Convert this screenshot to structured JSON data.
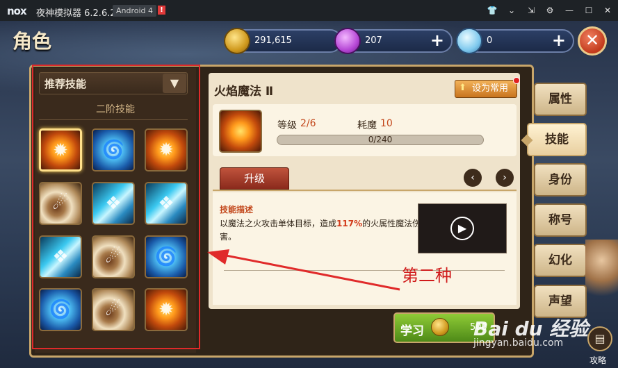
{
  "titlebar": {
    "logo": "nox",
    "app_title": "夜神模拟器 6.2.6.2",
    "android_badge": "Android 4",
    "warn_badge": "!",
    "icons": [
      "shirt-icon",
      "chevron-down-icon",
      "pin-icon",
      "gear-icon",
      "minimize-icon",
      "maximize-icon",
      "close-icon"
    ]
  },
  "header": {
    "page_title": "角色",
    "gold": "291,615",
    "gems": "207",
    "diamonds": "0",
    "plus": "+",
    "close": "✕"
  },
  "left": {
    "dropdown_label": "推荐技能",
    "dropdown_arrow": "▼",
    "tier_label": "二阶技能",
    "skills": [
      "fire",
      "tornado",
      "fire",
      "meteor",
      "crystal",
      "crystal",
      "crystal",
      "meteor",
      "tornado",
      "tornado",
      "meteor",
      "fire"
    ]
  },
  "detail": {
    "title": "火焰魔法 Ⅱ",
    "set_common": "设为常用",
    "level_label": "等级",
    "level_value": "2/6",
    "mana_label": "耗魔",
    "mana_value": "10",
    "xp_text": "0/240",
    "xp_progress": 0,
    "upgrade_tab": "升级",
    "prev": "‹",
    "next": "›",
    "desc_title": "技能描述",
    "desc_before": "以魔法之火攻击单体目标，造成",
    "desc_highlight": "117%",
    "desc_after": "的火属性魔法伤害。",
    "play": "▶",
    "annotation": "第二种",
    "learn_label": "学习",
    "learn_cost": "500"
  },
  "side_tabs": [
    "属性",
    "技能",
    "身份",
    "称号",
    "幻化",
    "声望"
  ],
  "side_tab_active": "技能",
  "watermark": "Bai du 经验",
  "watermark_sub": "jingyan.baidu.com",
  "guide": {
    "icon": "book-icon",
    "label": "攻略"
  },
  "colors": {
    "accent": "#c8a66a",
    "highlight": "#d23a1a",
    "annotation_red": "#e02a2a"
  }
}
